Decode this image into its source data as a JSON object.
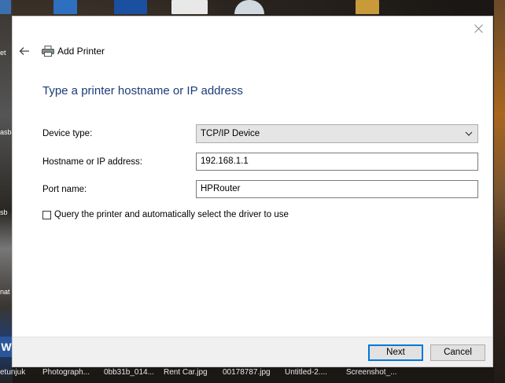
{
  "dialog": {
    "title": "Add Printer",
    "heading": "Type a printer hostname or IP address",
    "fields": {
      "device_type_label": "Device type:",
      "device_type_value": "TCP/IP Device",
      "hostname_label": "Hostname or IP address:",
      "hostname_value": "192.168.1.1",
      "port_label": "Port name:",
      "port_value": "HPRouter"
    },
    "checkbox_label": "Query the printer and automatically select the driver to use",
    "buttons": {
      "next": "Next",
      "cancel": "Cancel"
    }
  },
  "desktop": {
    "bottom_labels": [
      "etunjuk",
      "Photograph...",
      "0bb31b_014...",
      "Rent Car.jpg",
      "00178787.jpg",
      "Untitled-2....",
      "Screenshot_..."
    ],
    "left_labels": [
      "et",
      "asb",
      "sb",
      "nat"
    ]
  },
  "colors": {
    "heading": "#1e3a78",
    "primary_border": "#0078d7"
  }
}
